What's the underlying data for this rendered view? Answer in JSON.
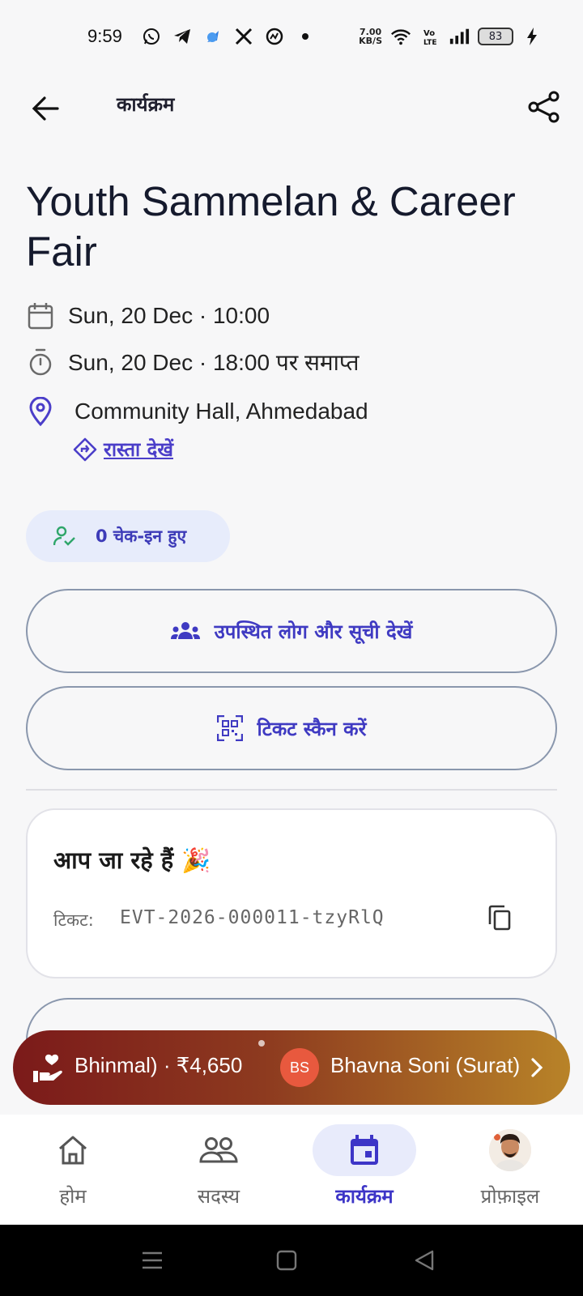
{
  "status_bar": {
    "time": "9:59",
    "net_speed_value": "7.00",
    "net_speed_unit": "KB/S",
    "battery": "83"
  },
  "topbar": {
    "title": "कार्यक्रम"
  },
  "event": {
    "title": "Youth Sammelan & Career Fair",
    "start": "Sun, 20 Dec · 10:00",
    "end": "Sun, 20 Dec · 18:00 पर समाप्त",
    "location": "Community Hall, Ahmedabad",
    "directions_label": "रास्ता देखें"
  },
  "checkin": {
    "label": "0 चेक-इन हुए"
  },
  "buttons": {
    "attendees_label": "उपस्थित लोग और सूची देखें",
    "scan_label": "टिकट स्कैन करें"
  },
  "ticket_card": {
    "heading": "आप जा रहे हैं 🎉",
    "ticket_label": "टिकट:",
    "ticket_code": "EVT-2026-000011-tzyRlQ"
  },
  "donation_banner": {
    "ticker_left": "Bhinmal) · ₹4,650",
    "avatar_initials": "BS",
    "ticker_right": "Bhavna Soni (Surat)"
  },
  "bottom_nav": {
    "home": "होम",
    "members": "सदस्य",
    "events": "कार्यक्रम",
    "profile": "प्रोफ़ाइल",
    "active": "events"
  },
  "colors": {
    "accent": "#3f3ac2",
    "chip_bg": "#e7ecfb",
    "banner_start": "#7b1a1a",
    "banner_end": "#b88328"
  }
}
